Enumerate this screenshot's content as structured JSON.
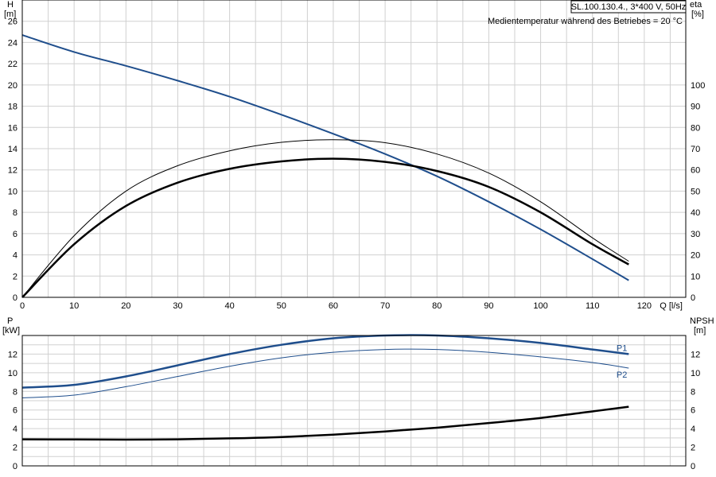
{
  "chart_data": [
    {
      "type": "line",
      "panel": "top",
      "title": "",
      "header_box": "SL.100.130.4., 3*400 V, 50Hz",
      "annotation": "Medientemperatur während des Betriebes = 20 °C",
      "xlabel": "Q [l/s]",
      "ylabel_left": [
        "H",
        "[m]"
      ],
      "ylabel_right": [
        "eta",
        "[%]"
      ],
      "xlim": [
        0,
        128
      ],
      "ylim_left": [
        0,
        28
      ],
      "ylim_right": [
        0,
        140
      ],
      "x_ticks": [
        "0",
        "10",
        "20",
        "30",
        "40",
        "50",
        "60",
        "70",
        "80",
        "90",
        "100",
        "110",
        "120"
      ],
      "y_ticks_left": [
        "0",
        "2",
        "4",
        "6",
        "8",
        "10",
        "12",
        "14",
        "16",
        "18",
        "20",
        "22",
        "24",
        "26"
      ],
      "y_ticks_right": [
        "0",
        "10",
        "20",
        "30",
        "40",
        "50",
        "60",
        "70",
        "80",
        "90",
        "100"
      ],
      "grid": true,
      "colors": {
        "head": "#1f4e8c",
        "eta": "#000000",
        "grid": "#d0d0d0"
      },
      "series": [
        {
          "axis": "left",
          "color": "#1f4e8c",
          "width": 2,
          "x": [
            0,
            10,
            20,
            30,
            40,
            50,
            60,
            70,
            80,
            90,
            100,
            110,
            117
          ],
          "y": [
            24.7,
            23.1,
            21.8,
            20.4,
            18.9,
            17.2,
            15.4,
            13.5,
            11.4,
            9.0,
            6.4,
            3.6,
            1.6
          ]
        },
        {
          "axis": "right",
          "color": "#000000",
          "width": 1,
          "x": [
            0,
            10,
            20,
            30,
            40,
            50,
            60,
            70,
            80,
            90,
            100,
            110,
            117
          ],
          "y": [
            0,
            29,
            50,
            62,
            69,
            73,
            74.2,
            72.8,
            67.5,
            58.5,
            45,
            28,
            17
          ]
        },
        {
          "axis": "right",
          "color": "#000000",
          "width": 2.5,
          "x": [
            0,
            10,
            20,
            30,
            40,
            50,
            60,
            70,
            80,
            90,
            100,
            110,
            117
          ],
          "y": [
            0,
            25,
            43,
            54,
            60.5,
            64,
            65.3,
            63.8,
            59.5,
            52,
            40,
            25,
            15.5
          ]
        }
      ]
    },
    {
      "type": "line",
      "panel": "bottom",
      "title": "",
      "xlim": [
        0,
        128
      ],
      "ylim_left": [
        0,
        14
      ],
      "ylim_right": [
        0,
        14
      ],
      "ylabel_left": [
        "P",
        "[kW]"
      ],
      "ylabel_right": [
        "NPSH",
        "[m]"
      ],
      "y_ticks_left": [
        "0",
        "2",
        "4",
        "6",
        "8",
        "10",
        "12"
      ],
      "y_ticks_right": [
        "0",
        "2",
        "4",
        "6",
        "8",
        "10",
        "12"
      ],
      "grid": true,
      "series": [
        {
          "name": "P1",
          "axis": "left",
          "color": "#1f4e8c",
          "width": 2.5,
          "x": [
            0,
            10,
            20,
            30,
            40,
            50,
            60,
            70,
            80,
            90,
            100,
            110,
            117
          ],
          "y": [
            8.4,
            8.7,
            9.6,
            10.8,
            12.0,
            13.0,
            13.7,
            14.0,
            14.0,
            13.7,
            13.2,
            12.5,
            12.0
          ]
        },
        {
          "name": "P2",
          "axis": "left",
          "color": "#1f4e8c",
          "width": 1,
          "x": [
            0,
            10,
            20,
            30,
            40,
            50,
            60,
            70,
            80,
            90,
            100,
            110,
            117
          ],
          "y": [
            7.3,
            7.6,
            8.5,
            9.6,
            10.7,
            11.6,
            12.2,
            12.5,
            12.5,
            12.2,
            11.7,
            11.1,
            10.5
          ]
        },
        {
          "axis": "right",
          "color": "#000000",
          "width": 2.5,
          "x": [
            0,
            10,
            20,
            30,
            40,
            50,
            60,
            70,
            80,
            90,
            100,
            110,
            117
          ],
          "y": [
            2.85,
            2.83,
            2.82,
            2.85,
            2.95,
            3.1,
            3.35,
            3.7,
            4.1,
            4.6,
            5.15,
            5.85,
            6.35
          ]
        }
      ]
    }
  ]
}
